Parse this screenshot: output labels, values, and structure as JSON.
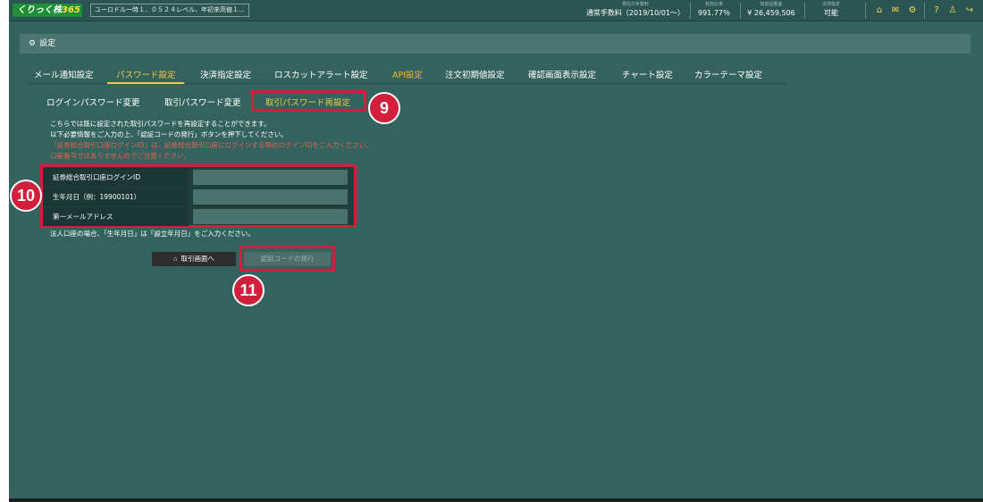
{
  "header": {
    "logo_main": "くりっく株",
    "logo_accent": "365",
    "ticker": "ユーロドル一時１．０５２４レベル、年初来高値１...",
    "fee_label": "現在の手数料",
    "fee_value": "通常手数料（2019/10/01〜）",
    "margin_ratio_label": "有効比率",
    "margin_ratio_value": "991.77％",
    "margin_label": "有効証拠金",
    "margin_value": "¥ 26,459,506",
    "settlement_label": "決済指定",
    "settlement_value": "可能"
  },
  "settings_title": "設定",
  "main_tabs": [
    {
      "label": "メール通知設定"
    },
    {
      "label": "パスワード設定"
    },
    {
      "label": "決済指定設定"
    },
    {
      "label": "ロスカットアラート設定"
    },
    {
      "label": "API設定"
    },
    {
      "label": "注文初期値設定"
    },
    {
      "label": "確認画面表示設定"
    },
    {
      "label": "チャート設定"
    },
    {
      "label": "カラーテーマ設定"
    }
  ],
  "sub_tabs": [
    {
      "label": "ログインパスワード変更"
    },
    {
      "label": "取引パスワード変更"
    },
    {
      "label": "取引パスワード再設定"
    }
  ],
  "info_lines": [
    "こちらでは既に設定された取引パスワードを再設定することができます。",
    "以下必要情報をご入力の上、「認証コードの発行」ボタンを押下してください。",
    "「証券総合取引口座ログインID」は、証券総合取引口座にログインする際のログインIDをご入力ください。",
    "口座番号ではありませんのでご注意ください。"
  ],
  "form": {
    "rows": [
      {
        "label": "証券総合取引口座ログインID",
        "value": ""
      },
      {
        "label": "生年月日（例：19900101）",
        "value": ""
      },
      {
        "label": "第一メールアドレス",
        "value": ""
      }
    ]
  },
  "note": "法人口座の場合、「生年月日」は「設立年月日」をご入力ください。",
  "buttons": {
    "home": "取引画面へ",
    "auth": "認証コードの発行"
  },
  "callouts": {
    "c9": "9",
    "c10": "10",
    "c11": "11"
  }
}
